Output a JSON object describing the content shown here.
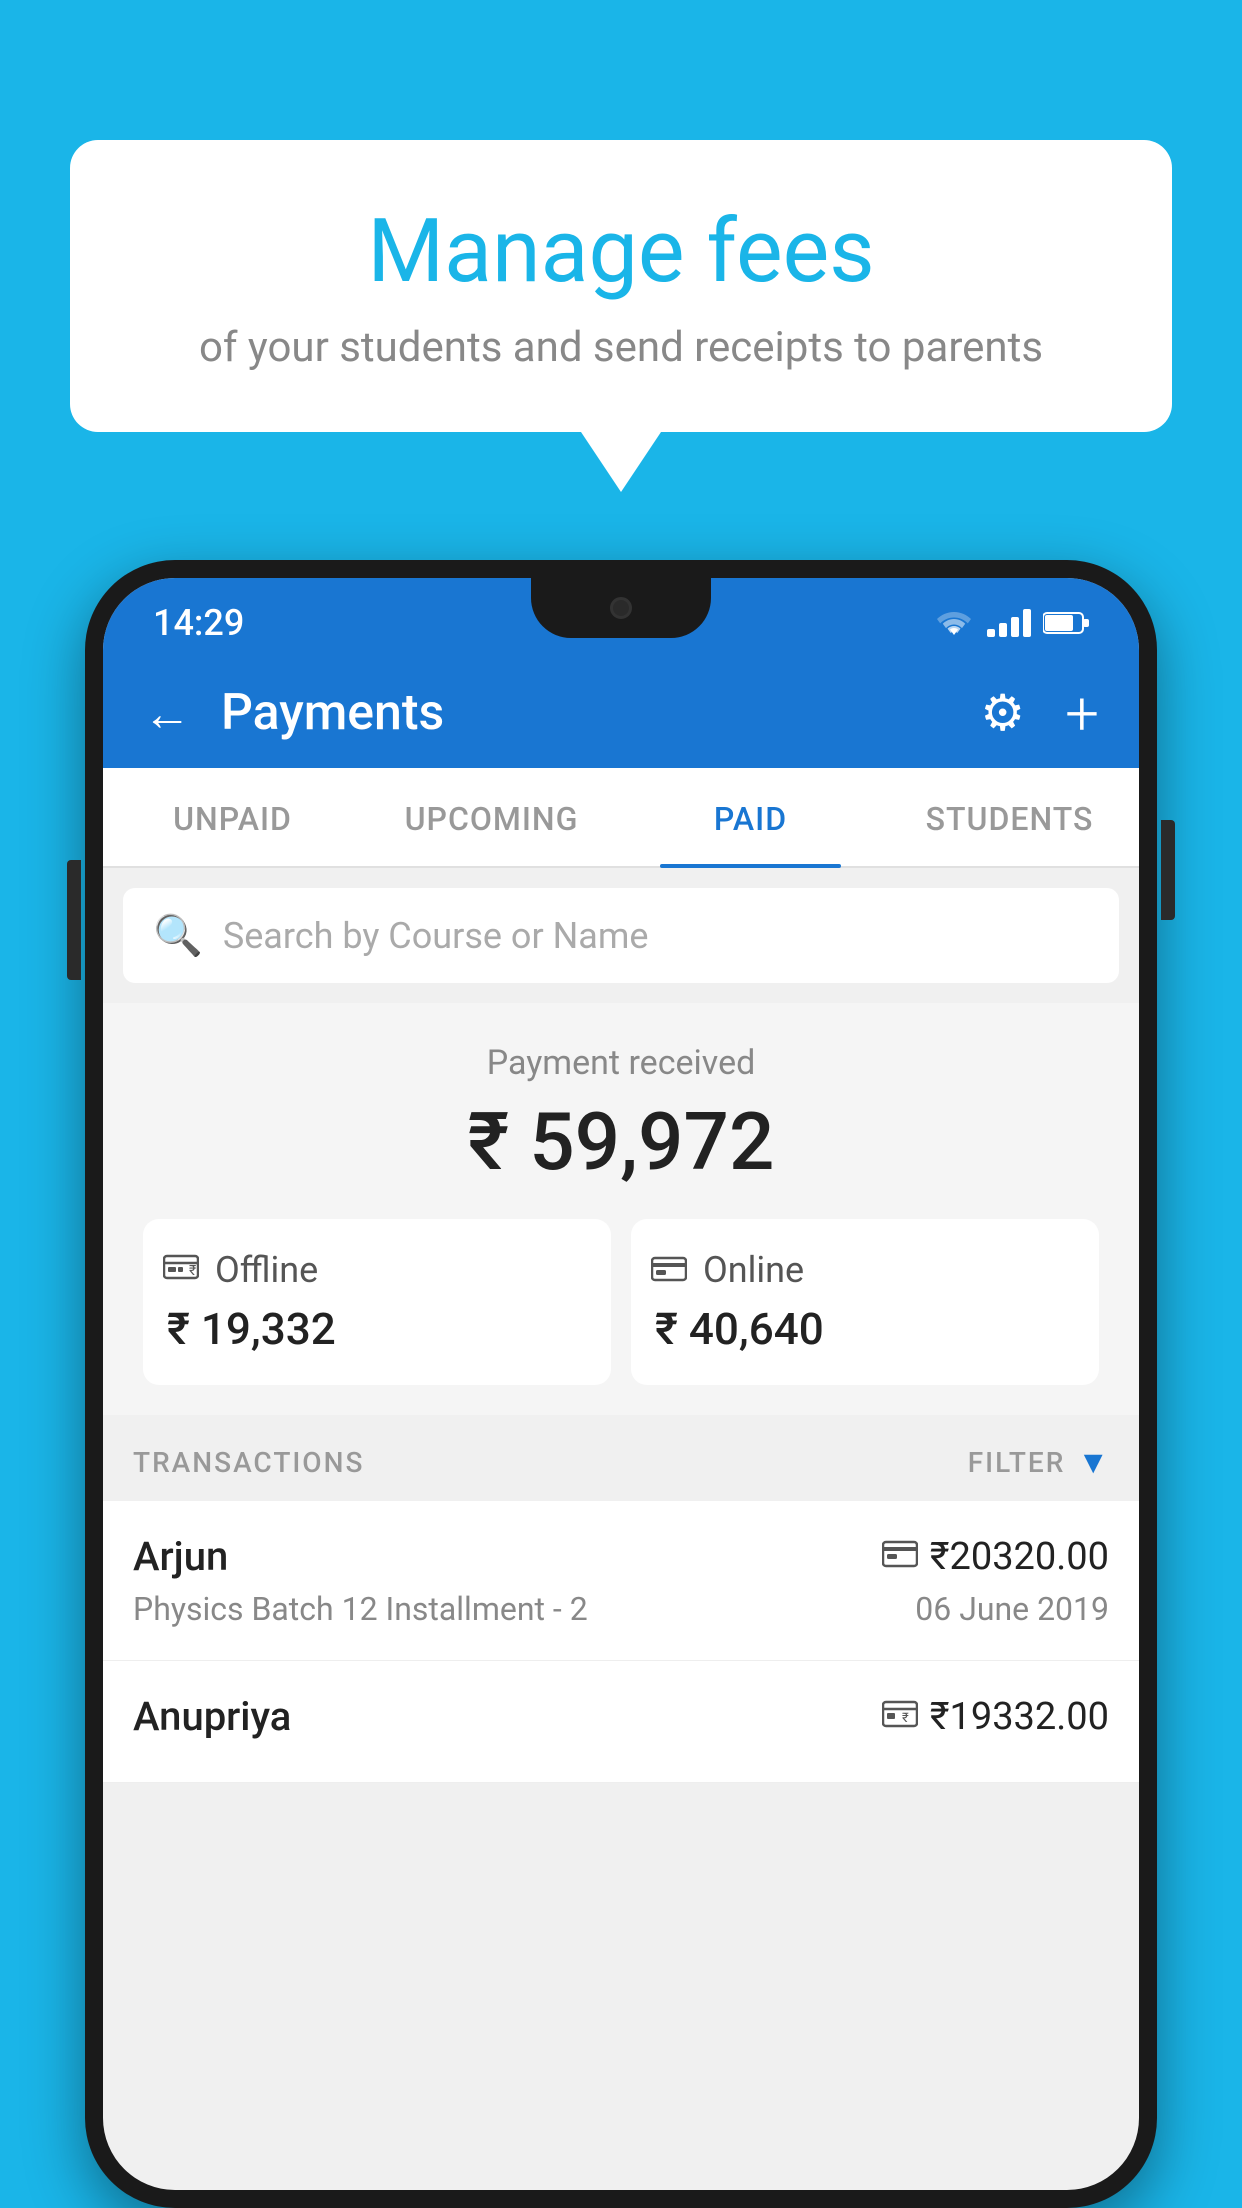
{
  "background": {
    "color": "#1ab5e8"
  },
  "speech_bubble": {
    "title": "Manage fees",
    "subtitle": "of your students and send receipts to parents"
  },
  "status_bar": {
    "time": "14:29"
  },
  "app_header": {
    "title": "Payments"
  },
  "tabs": [
    {
      "label": "UNPAID",
      "active": false
    },
    {
      "label": "UPCOMING",
      "active": false
    },
    {
      "label": "PAID",
      "active": true
    },
    {
      "label": "STUDENTS",
      "active": false
    }
  ],
  "search": {
    "placeholder": "Search by Course or Name"
  },
  "payment_summary": {
    "label": "Payment received",
    "amount": "₹ 59,972",
    "offline": {
      "label": "Offline",
      "amount": "₹ 19,332"
    },
    "online": {
      "label": "Online",
      "amount": "₹ 40,640"
    }
  },
  "transactions": {
    "header": "TRANSACTIONS",
    "filter": "FILTER",
    "rows": [
      {
        "name": "Arjun",
        "detail": "Physics Batch 12 Installment - 2",
        "amount": "₹20320.00",
        "method": "card",
        "date": "06 June 2019"
      },
      {
        "name": "Anupriya",
        "detail": "",
        "amount": "₹19332.00",
        "method": "offline",
        "date": ""
      }
    ]
  }
}
